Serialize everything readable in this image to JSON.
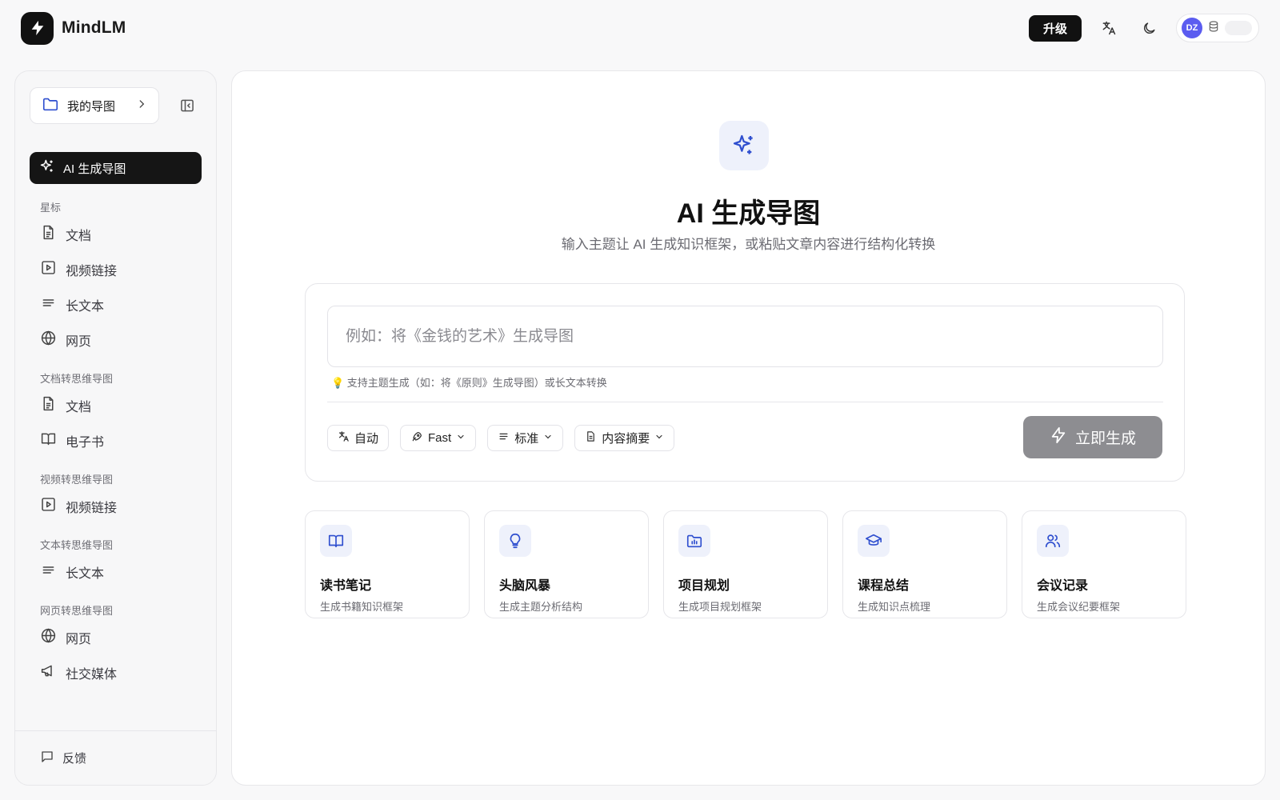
{
  "header": {
    "brand_name": "MindLM",
    "upgrade_label": "升级",
    "avatar_initials": "DZ"
  },
  "sidebar": {
    "folder_label": "我的导图",
    "ai_nav_label": "AI 生成导图",
    "sections": [
      {
        "title": "星标",
        "items": [
          {
            "label": "文档",
            "icon": "document-icon"
          },
          {
            "label": "视频链接",
            "icon": "play-icon"
          },
          {
            "label": "长文本",
            "icon": "text-lines-icon"
          },
          {
            "label": "网页",
            "icon": "globe-icon"
          }
        ]
      },
      {
        "title": "文档转思维导图",
        "items": [
          {
            "label": "文档",
            "icon": "document-icon"
          },
          {
            "label": "电子书",
            "icon": "book-icon"
          }
        ]
      },
      {
        "title": "视频转思维导图",
        "items": [
          {
            "label": "视频链接",
            "icon": "play-icon"
          }
        ]
      },
      {
        "title": "文本转思维导图",
        "items": [
          {
            "label": "长文本",
            "icon": "text-lines-icon"
          }
        ]
      },
      {
        "title": "网页转思维导图",
        "items": [
          {
            "label": "网页",
            "icon": "globe-icon"
          },
          {
            "label": "社交媒体",
            "icon": "megaphone-icon"
          }
        ]
      }
    ],
    "feedback_label": "反馈"
  },
  "main": {
    "title": "AI 生成导图",
    "subtitle": "输入主题让 AI 生成知识框架，或粘贴文章内容进行结构化转换",
    "input_placeholder": "例如：将《金钱的艺术》生成导图",
    "input_value": "",
    "hint": "💡 支持主题生成（如：将《原则》生成导图）或长文本转换",
    "options": {
      "language": "自动",
      "model": "Fast",
      "length": "标准",
      "mode": "内容摘要"
    },
    "generate_label": "立即生成",
    "templates": [
      {
        "title": "读书笔记",
        "desc": "生成书籍知识框架",
        "icon": "book-open-icon"
      },
      {
        "title": "头脑风暴",
        "desc": "生成主题分析结构",
        "icon": "lightbulb-icon"
      },
      {
        "title": "项目规划",
        "desc": "生成项目规划框架",
        "icon": "folder-chart-icon"
      },
      {
        "title": "课程总结",
        "desc": "生成知识点梳理",
        "icon": "graduation-cap-icon"
      },
      {
        "title": "会议记录",
        "desc": "生成会议纪要框架",
        "icon": "users-icon"
      }
    ]
  },
  "colors": {
    "accent": "#2f4fcf",
    "dark": "#151515",
    "avatar": "#5b5cf0",
    "disabled_button": "#8d8d91"
  }
}
